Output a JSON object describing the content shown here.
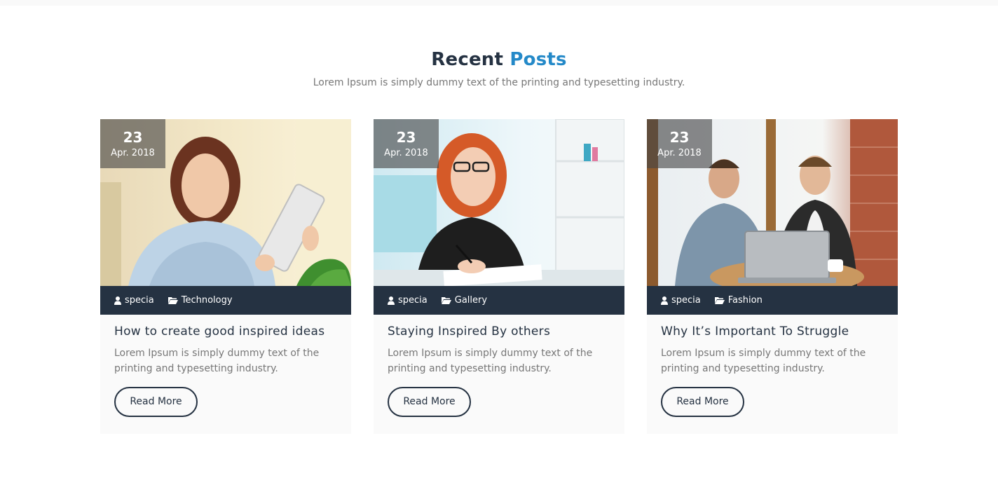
{
  "section": {
    "title_main": "Recent",
    "title_accent": "Posts",
    "subtitle": "Lorem Ipsum is simply dummy text of the printing and typesetting industry."
  },
  "colors": {
    "navy": "#253242",
    "accent": "#2489c8",
    "muted": "#777777"
  },
  "posts": [
    {
      "day": "23",
      "month": "Apr. 2018",
      "author": "specia",
      "category": "Technology",
      "title": "How to create good inspired ideas",
      "excerpt": "Lorem Ipsum is simply dummy text of the printing and typesetting industry.",
      "button": "Read More",
      "author_icon": "user-icon",
      "category_icon": "folder-open-icon"
    },
    {
      "day": "23",
      "month": "Apr. 2018",
      "author": "specia",
      "category": "Gallery",
      "title": "Staying Inspired By others",
      "excerpt": "Lorem Ipsum is simply dummy text of the printing and typesetting industry.",
      "button": "Read More",
      "author_icon": "user-icon",
      "category_icon": "folder-open-icon"
    },
    {
      "day": "23",
      "month": "Apr. 2018",
      "author": "specia",
      "category": "Fashion",
      "title": "Why It’s Important To Struggle",
      "excerpt": "Lorem Ipsum is simply dummy text of the printing and typesetting industry.",
      "button": "Read More",
      "author_icon": "user-icon",
      "category_icon": "folder-open-icon"
    }
  ]
}
